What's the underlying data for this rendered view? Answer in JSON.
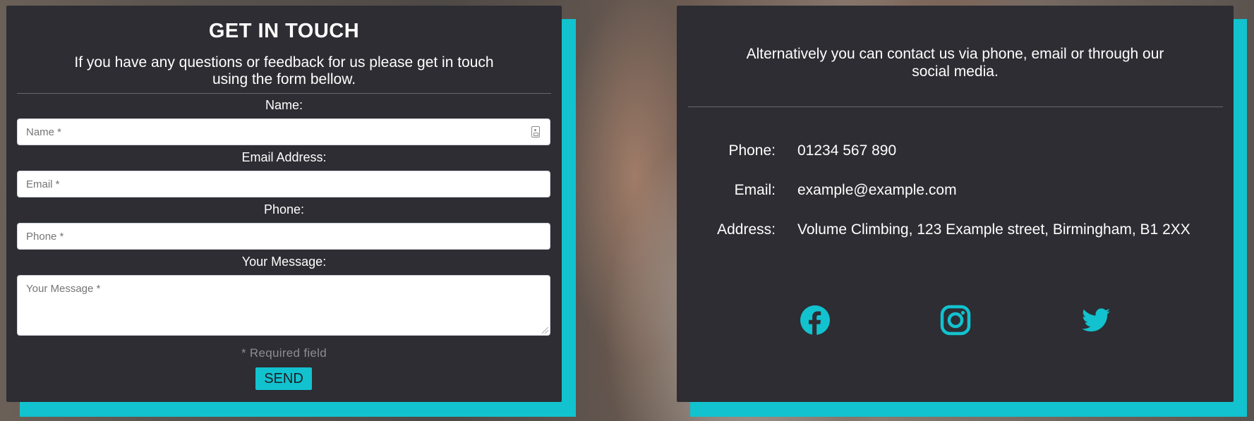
{
  "form": {
    "title": "GET IN TOUCH",
    "subtitle": "If you have any questions or feedback for us please get in touch using the form bellow.",
    "name_label": "Name:",
    "name_placeholder": "Name *",
    "email_label": "Email Address:",
    "email_placeholder": "Email *",
    "phone_label": "Phone:",
    "phone_placeholder": "Phone *",
    "message_label": "Your Message:",
    "message_placeholder": "Your Message *",
    "required_note": "* Required field",
    "send_label": "SEND"
  },
  "contact": {
    "intro": "Alternatively you can contact us via phone, email or through our social media.",
    "phone_label": "Phone:",
    "phone_value": "01234 567 890",
    "email_label": "Email:",
    "email_value": "example@example.com",
    "address_label": "Address:",
    "address_value": "Volume Climbing, 123 Example street, Birmingham, B1 2XX"
  },
  "social": [
    {
      "icon": "facebook-icon"
    },
    {
      "icon": "instagram-icon"
    },
    {
      "icon": "twitter-icon"
    }
  ],
  "colors": {
    "accent": "#12c2cf",
    "card_background": "#2d2d33",
    "text": "#ffffff",
    "muted_text": "#8c8c92"
  }
}
